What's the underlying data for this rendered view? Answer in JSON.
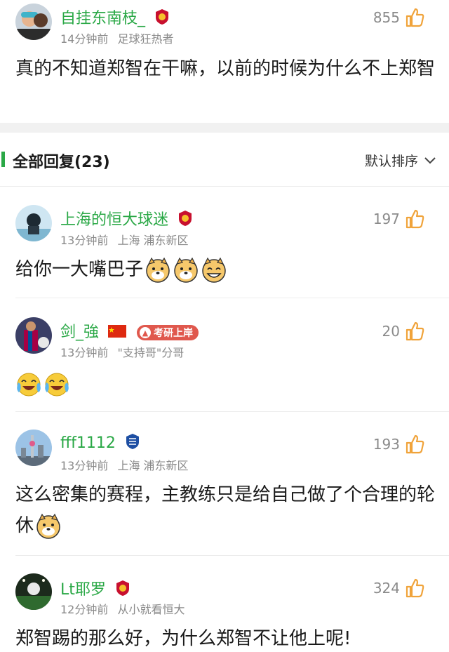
{
  "top_comment": {
    "username": "自挂东南枝_",
    "time": "14分钟前",
    "badge_text": "足球狂热者",
    "likes": "855",
    "text": "真的不知道郑智在干嘛，以前的时候为什么不上郑智"
  },
  "replies_header": {
    "title": "全部回复(23)",
    "sort_label": "默认排序"
  },
  "replies": [
    {
      "username": "上海的恒大球迷",
      "time": "13分钟前",
      "location": "上海 浦东新区",
      "likes": "197",
      "text": "给你一大嘴巴子"
    },
    {
      "username": "剑_強",
      "time": "13分钟前",
      "location": "\"支持哥\"分哥",
      "tag": "考研上岸",
      "likes": "20",
      "text": ""
    },
    {
      "username": "fff1112",
      "time": "13分钟前",
      "location": "上海 浦东新区",
      "likes": "193",
      "text": "这么密集的赛程，主教练只是给自己做了个合理的轮休"
    },
    {
      "username": "Lt耶罗",
      "time": "12分钟前",
      "location": "从小就看恒大",
      "likes": "324",
      "text": "郑智踢的那么好，为什么郑智不让他上呢!"
    }
  ],
  "colors": {
    "username": "#2aa846",
    "like_icon": "#f0a33a",
    "meta": "#8a8a8a"
  }
}
